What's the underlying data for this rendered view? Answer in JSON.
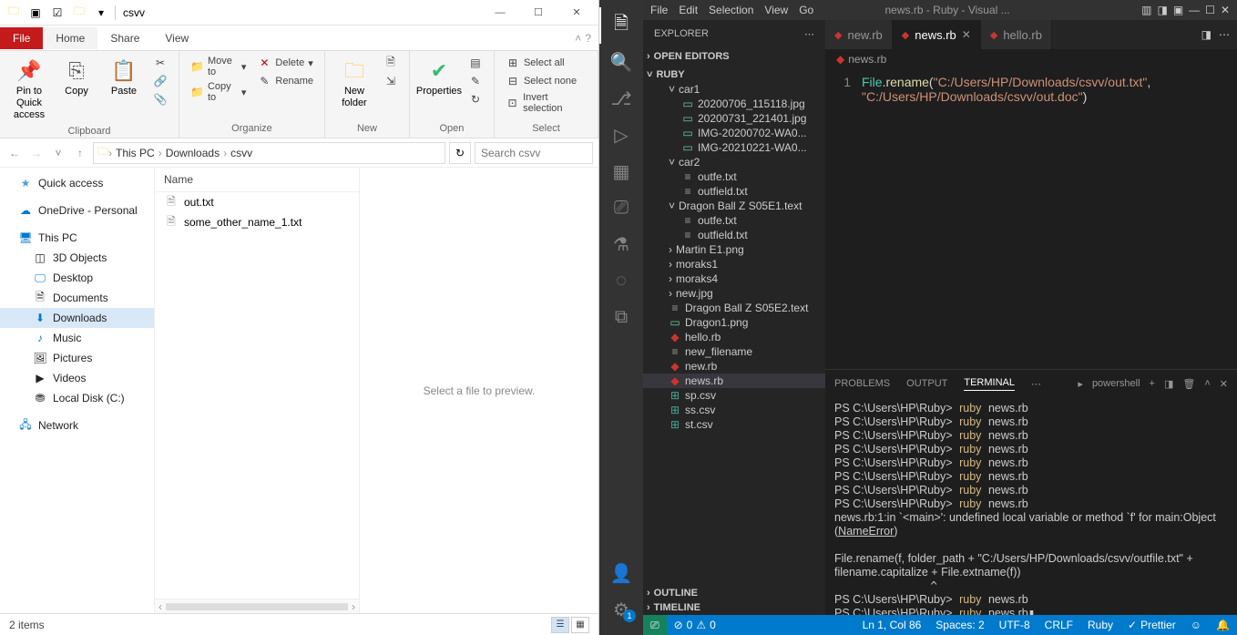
{
  "explorer": {
    "title": "csvv",
    "tabs": {
      "file": "File",
      "home": "Home",
      "share": "Share",
      "view": "View"
    },
    "ribbon": {
      "clipboard": {
        "label": "Clipboard",
        "pin": "Pin to Quick access",
        "copy": "Copy",
        "paste": "Paste"
      },
      "organize": {
        "label": "Organize",
        "moveto": "Move to",
        "copyto": "Copy to",
        "delete": "Delete",
        "rename": "Rename"
      },
      "new": {
        "label": "New",
        "newfolder": "New folder"
      },
      "open": {
        "label": "Open",
        "properties": "Properties"
      },
      "select": {
        "label": "Select",
        "all": "Select all",
        "none": "Select none",
        "invert": "Invert selection"
      }
    },
    "breadcrumb": [
      "This PC",
      "Downloads",
      "csvv"
    ],
    "search_placeholder": "Search csvv",
    "nav": {
      "quick_access": "Quick access",
      "onedrive": "OneDrive - Personal",
      "this_pc": "This PC",
      "items": [
        "3D Objects",
        "Desktop",
        "Documents",
        "Downloads",
        "Music",
        "Pictures",
        "Videos",
        "Local Disk (C:)"
      ],
      "network": "Network"
    },
    "files": {
      "header": "Name",
      "items": [
        "out.txt",
        "some_other_name_1.txt"
      ]
    },
    "preview": "Select a file to preview.",
    "status": "2 items"
  },
  "vscode": {
    "menubar": [
      "File",
      "Edit",
      "Selection",
      "View",
      "Go"
    ],
    "window_title": "news.rb - Ruby - Visual ...",
    "sidebar_title": "EXPLORER",
    "open_editors": "OPEN EDITORS",
    "root": "RUBY",
    "tree": {
      "car1": "car1",
      "car1_items": [
        "20200706_115118.jpg",
        "20200731_221401.jpg",
        "IMG-20200702-WA0...",
        "IMG-20210221-WA0..."
      ],
      "car2": "car2",
      "car2_items": [
        "outfe.txt",
        "outfield.txt"
      ],
      "dragonball": "Dragon Ball Z S05E1.text",
      "db_items": [
        "outfe.txt",
        "outfield.txt"
      ],
      "folders": [
        "Martin E1.png",
        "moraks1",
        "moraks4",
        "new.jpg"
      ],
      "files": [
        "Dragon Ball Z S05E2.text",
        "Dragon1.png",
        "hello.rb",
        "new_filename",
        "new.rb",
        "news.rb",
        "sp.csv",
        "ss.csv",
        "st.csv"
      ]
    },
    "outline": "OUTLINE",
    "timeline": "TIMELINE",
    "tabs": [
      "new.rb",
      "news.rb",
      "hello.rb"
    ],
    "active_tab": "news.rb",
    "breadcrumb": "news.rb",
    "code": {
      "line_no": "1",
      "class": "File",
      "method": "rename",
      "arg1": "\"C:/Users/HP/Downloads/csvv/out.txt\"",
      "arg2": "\"C:/Users/HP/Downloads/csvv/out.doc\""
    },
    "panel_tabs": {
      "problems": "PROBLEMS",
      "output": "OUTPUT",
      "terminal": "TERMINAL"
    },
    "shell_name": "powershell",
    "terminal": {
      "prompt": "PS C:\\Users\\HP\\Ruby>",
      "cmd": "ruby",
      "file": "news.rb",
      "err": "news.rb:1:in `<main>': undefined local variable or method `f' for main:Object (NameError)",
      "trace": "File.rename(f, folder_path + \"C:/Users/HP/Downloads/csvv/outfile.txt\" + filename.capitalize + File.extname(f))"
    },
    "statusbar": {
      "errors": "0",
      "warnings": "0",
      "cursor": "Ln 1, Col 86",
      "spaces": "Spaces: 2",
      "encoding": "UTF-8",
      "eol": "CRLF",
      "lang": "Ruby",
      "prettier": "Prettier"
    }
  }
}
